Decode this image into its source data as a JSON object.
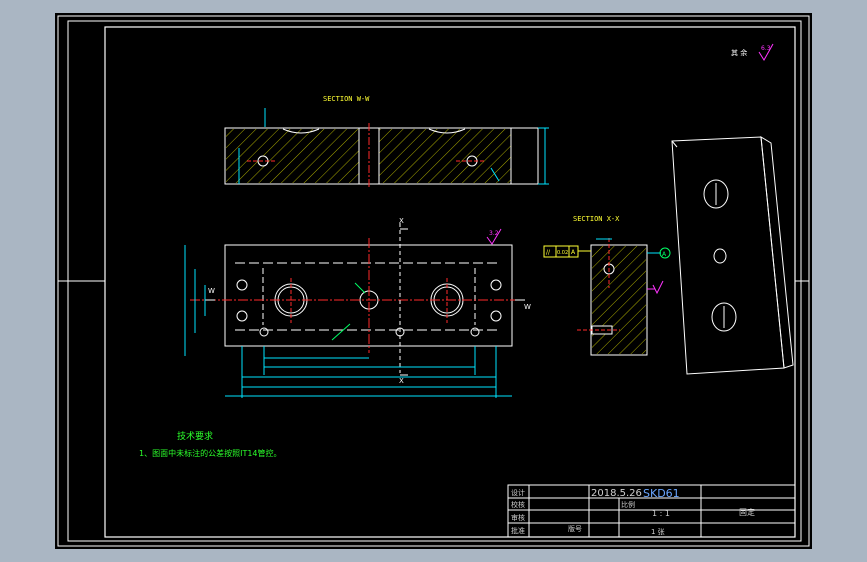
{
  "sections": {
    "ww_title": "SECTION W-W",
    "xx_title": "SECTION X-X",
    "w_marker": "W",
    "x_marker": "X"
  },
  "roughness": {
    "corner_label": "其 余",
    "corner_value": "6.3",
    "plan_value": "3.2"
  },
  "tolerance_frame": {
    "symbol": "//",
    "value": "0.02",
    "datum": "A"
  },
  "datum_label": "A",
  "notes": {
    "heading": "技术要求",
    "item1": "1、图面中未标注的公差按照IT14管控。"
  },
  "title_block": {
    "date": "2018.5.26",
    "material": "SKD61",
    "scale_label": "比例",
    "scale": "1 : 1",
    "sheet": "1 张",
    "part_name": "固定",
    "row_labels": [
      "设计",
      "校核",
      "审核",
      "批准"
    ],
    "version_label": "版号"
  },
  "colors": {
    "outline": "#ffffff",
    "centerline": "#ff2a2a",
    "dimension": "#00e5ff",
    "hatch": "#d4d400",
    "notes": "#2bff2b",
    "symbol": "#ff33ff",
    "title_text": "#cfcfcf"
  }
}
